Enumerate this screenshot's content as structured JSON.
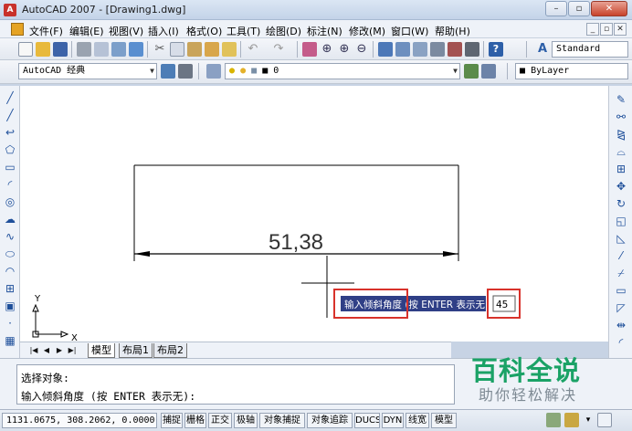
{
  "window": {
    "title": "AutoCAD 2007 - [Drawing1.dwg]",
    "app_icon": "autocad-logo-icon"
  },
  "menu": {
    "items": [
      "文件(F)",
      "编辑(E)",
      "视图(V)",
      "插入(I)",
      "格式(O)",
      "工具(T)",
      "绘图(D)",
      "标注(N)",
      "修改(M)",
      "窗口(W)",
      "帮助(H)"
    ]
  },
  "toolbar": {
    "text_style": "Standard"
  },
  "workspace": {
    "name": "AutoCAD 经典",
    "layer": "0",
    "color": "ByLayer"
  },
  "drawing": {
    "dimension_text": "51,38",
    "prompt": "输入倾斜角度 (按 ENTER 表示无):",
    "input_value": "45",
    "ucs_y": "Y",
    "ucs_x": "X"
  },
  "layout_tabs": [
    "模型",
    "布局1",
    "布局2"
  ],
  "command_line": {
    "line1": "选择对象:",
    "line2": "输入倾斜角度 (按 ENTER 表示无):"
  },
  "status": {
    "coordinates": "1131.0675, 308.2062, 0.0000",
    "toggles": [
      "捕捉",
      "栅格",
      "正交",
      "极轴",
      "对象捕捉",
      "对象追踪",
      "DUCS",
      "DYN",
      "线宽",
      "模型"
    ]
  },
  "watermark": {
    "title": "百科全说",
    "subtitle": "助你轻松解决"
  },
  "colors": {
    "highlight_border": "#d8322b",
    "prompt_bg": "#2f3f86",
    "canvas_bg": "#ffffff"
  }
}
